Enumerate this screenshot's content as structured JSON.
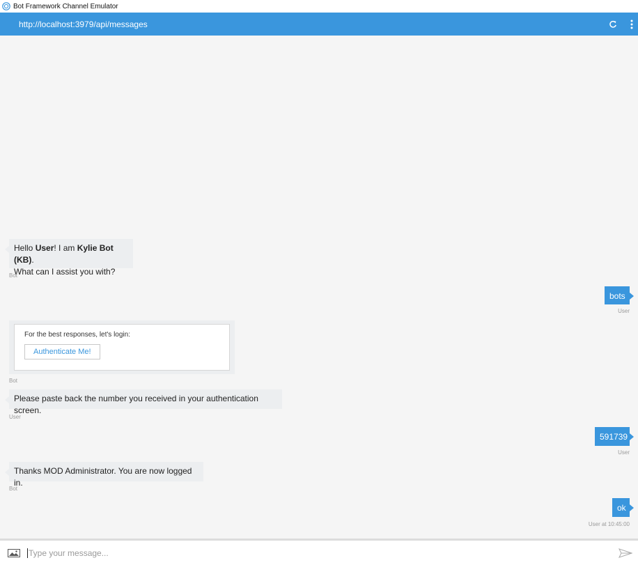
{
  "window": {
    "title": "Bot Framework Channel Emulator"
  },
  "topbar": {
    "url": "http://localhost:3979/api/messages"
  },
  "messages": {
    "m1": {
      "line1_prefix": "Hello ",
      "line1_user": "User",
      "line1_mid": "! I am ",
      "line1_bot": "Kylie Bot (KB)",
      "line1_suffix": ".",
      "line2": "What can I assist you with?",
      "sender": "Bot"
    },
    "m2": {
      "text": "bots",
      "sender": "User"
    },
    "m3": {
      "card_text": "For the best responses, let's login:",
      "button_label": "Authenticate Me!",
      "sender": "Bot"
    },
    "m4": {
      "text": "Please paste back the number you received in your authentication screen.",
      "sender": "User"
    },
    "m5": {
      "text": "591739",
      "sender": "User"
    },
    "m6": {
      "text": "Thanks MOD Administrator. You are now logged in.",
      "sender": "Bot"
    },
    "m7": {
      "text": "ok",
      "sender": "User at 10:45:00"
    }
  },
  "composer": {
    "placeholder": "Type your message..."
  },
  "colors": {
    "accent": "#3a96dd",
    "bot_bubble": "#eceef0",
    "background": "#f5f5f5"
  }
}
